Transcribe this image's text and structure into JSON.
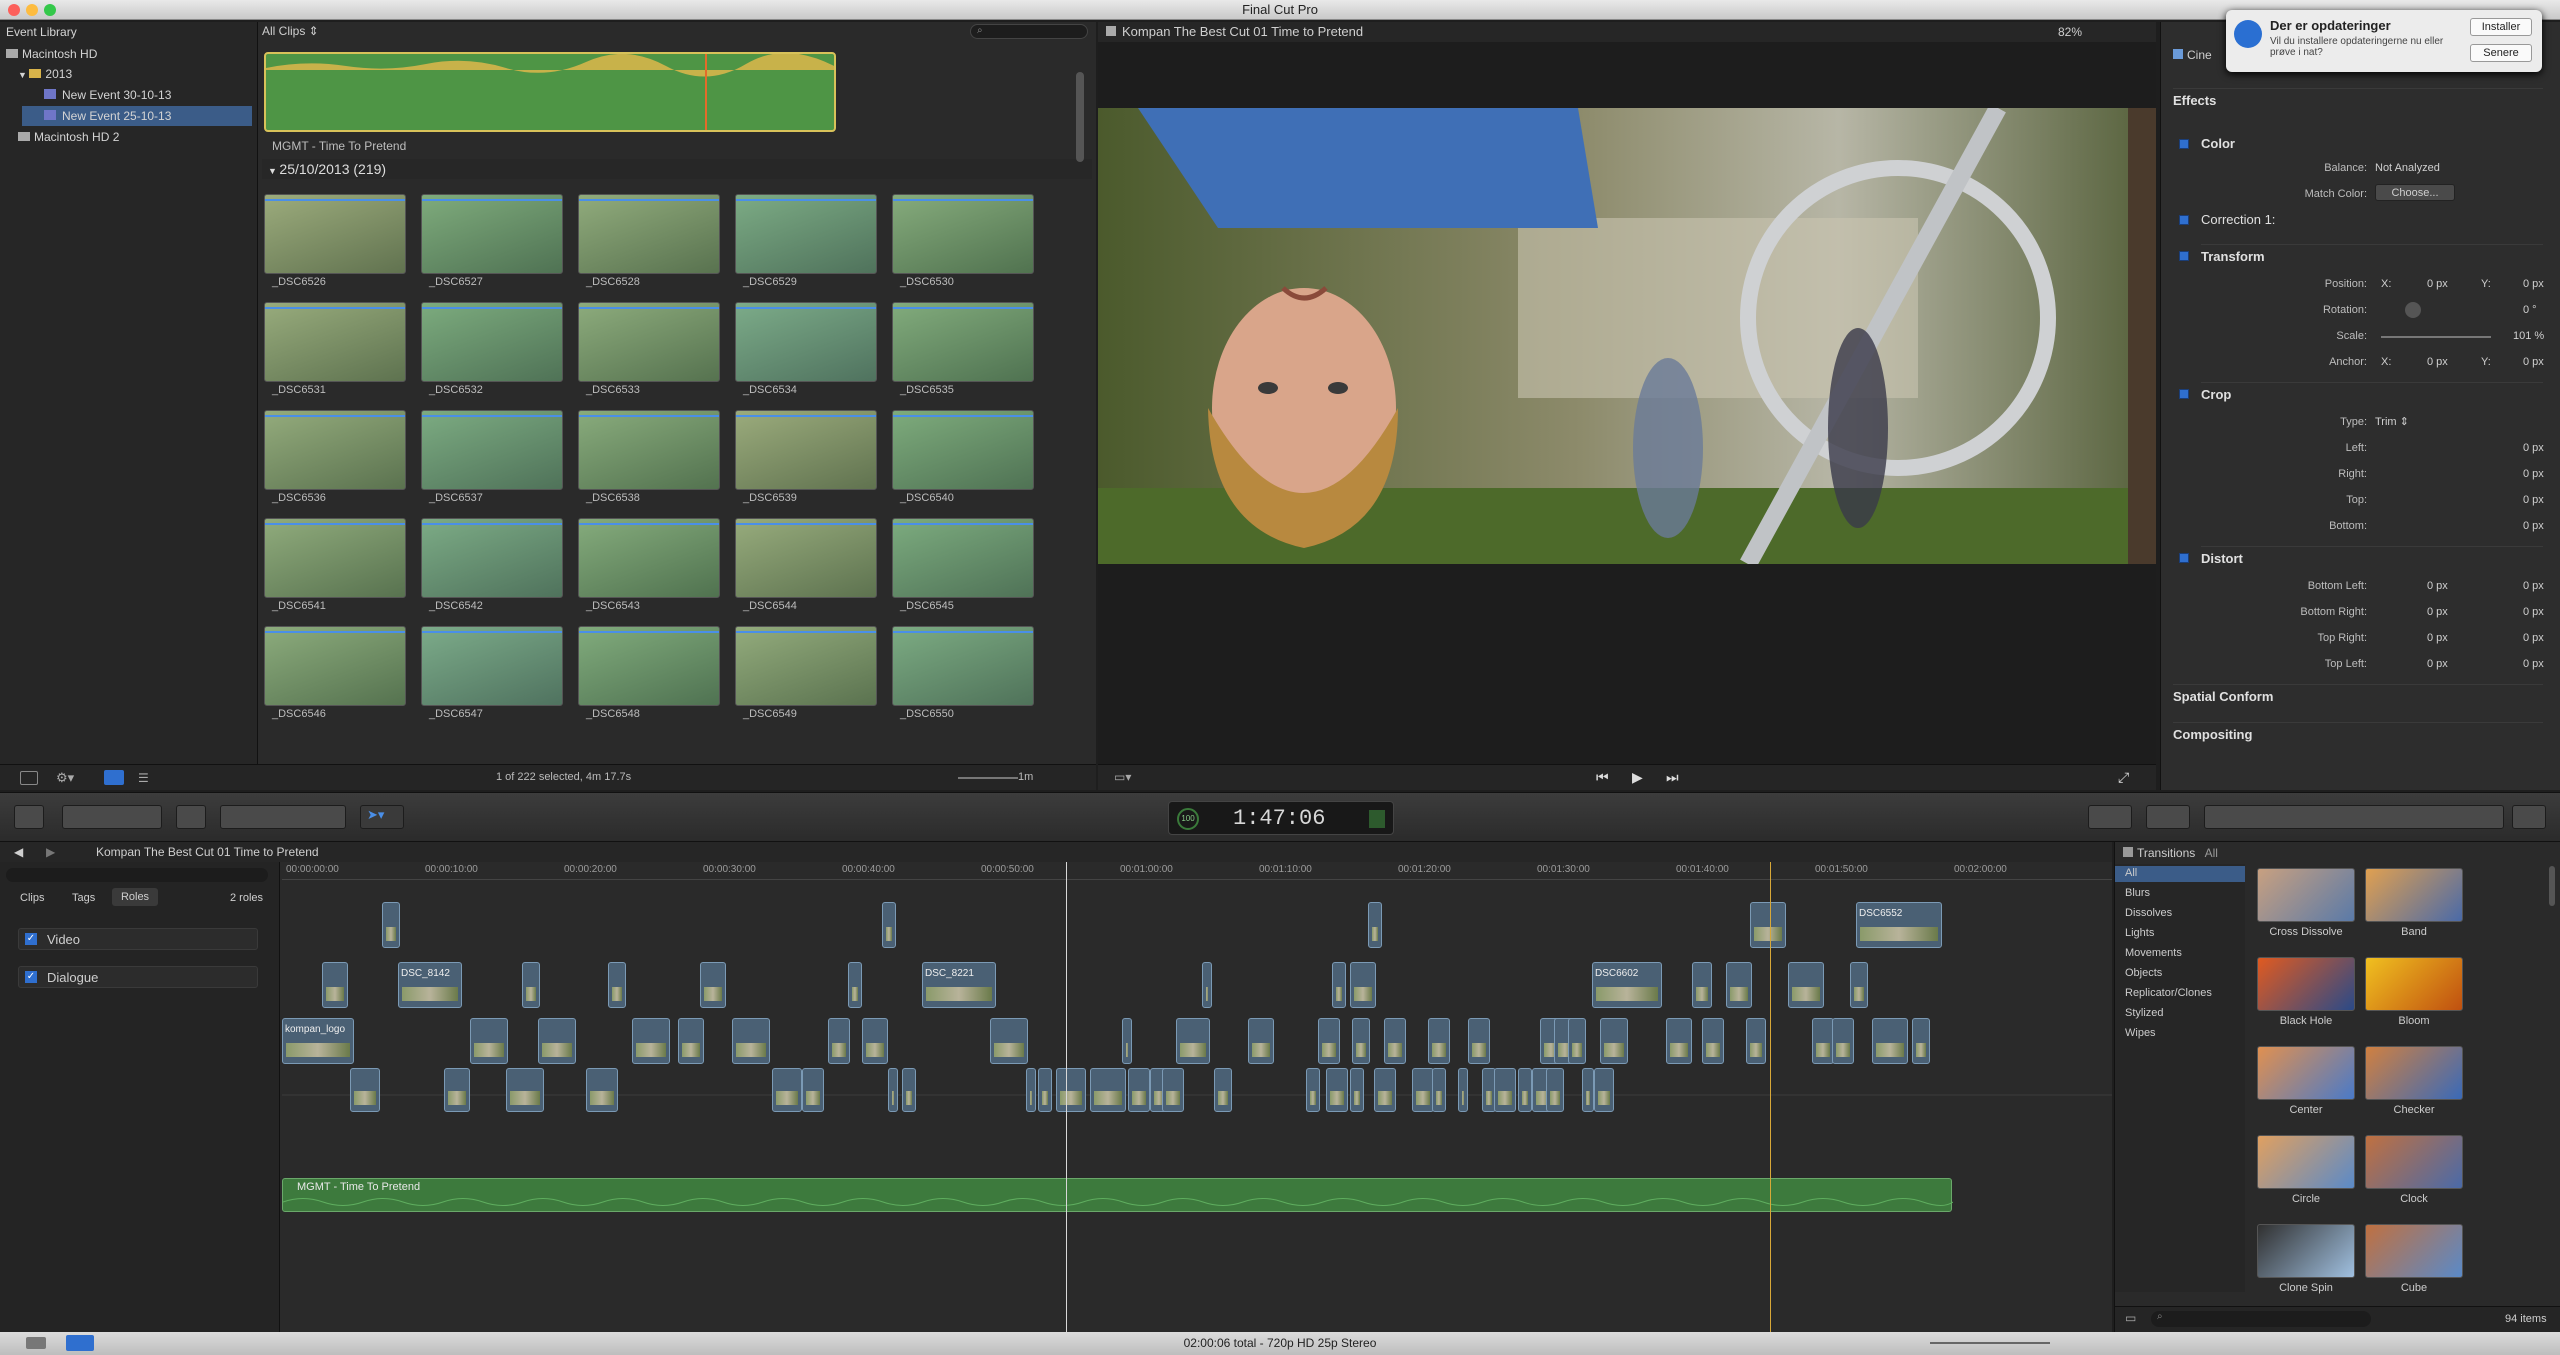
{
  "app": {
    "title": "Final Cut Pro"
  },
  "library": {
    "header": "Event Library",
    "items": [
      {
        "label": "Macintosh HD",
        "level": 0
      },
      {
        "label": "2013",
        "level": 1
      },
      {
        "label": "New Event 30-10-13",
        "level": 2
      },
      {
        "label": "New Event 25-10-13",
        "level": 2,
        "selected": true
      },
      {
        "label": "Macintosh HD 2",
        "level": 0
      }
    ]
  },
  "browser": {
    "filter": "All Clips",
    "project_clip_label": "MGMT - Time To Pretend",
    "date_group": "25/10/2013  (219)",
    "clips": [
      "_DSC6526",
      "_DSC6527",
      "_DSC6528",
      "_DSC6529",
      "_DSC6530",
      "_DSC6531",
      "_DSC6532",
      "_DSC6533",
      "_DSC6534",
      "_DSC6535",
      "_DSC6536",
      "_DSC6537",
      "_DSC6538",
      "_DSC6539",
      "_DSC6540",
      "_DSC6541",
      "_DSC6542",
      "_DSC6543",
      "_DSC6544",
      "_DSC6545",
      "_DSC6546",
      "_DSC6547",
      "_DSC6548",
      "_DSC6549",
      "_DSC6550"
    ],
    "status": "1 of 222 selected, 4m 17.7s",
    "zoom_label": "1m"
  },
  "viewer": {
    "title": "Kompan The Best Cut 01 Time to Pretend",
    "zoom": "82%"
  },
  "notification": {
    "title": "Der er opdateringer",
    "body": "Vil du installere opdateringerne nu eller prøve i nat?",
    "install": "Installer",
    "later": "Senere"
  },
  "inspector": {
    "tab": "Cine",
    "effects": "Effects",
    "color": "Color",
    "balance_label": "Balance:",
    "balance_value": "Not Analyzed",
    "match_label": "Match Color:",
    "match_button": "Choose...",
    "correction": "Correction 1:",
    "transform": "Transform",
    "position_label": "Position:",
    "rotation_label": "Rotation:",
    "rotation_value": "0 °",
    "scale_label": "Scale:",
    "scale_value": "101 %",
    "anchor_label": "Anchor:",
    "x": "X:",
    "y": "Y:",
    "px0": "0 px",
    "crop": "Crop",
    "type_label": "Type:",
    "type_value": "Trim",
    "left_label": "Left:",
    "right_label": "Right:",
    "top_label": "Top:",
    "bottom_label": "Bottom:",
    "distort": "Distort",
    "bl_label": "Bottom Left:",
    "br_label": "Bottom Right:",
    "tr_label": "Top Right:",
    "tlf_label": "Top Left:",
    "spatial": "Spatial Conform",
    "compositing": "Compositing"
  },
  "toolbar": {
    "timecode": "1:47:06",
    "tc_prefix": "100"
  },
  "timeline": {
    "project": "Kompan The Best Cut 01 Time to Pretend",
    "index_tabs": [
      "Clips",
      "Tags",
      "Roles"
    ],
    "roles_count": "2 roles",
    "roles": [
      "Video",
      "Dialogue"
    ],
    "ruler": [
      "00:00:00:00",
      "00:00:10:00",
      "00:00:20:00",
      "00:00:30:00",
      "00:00:40:00",
      "00:00:50:00",
      "00:01:00:00",
      "00:01:10:00",
      "00:01:20:00",
      "00:01:30:00",
      "00:01:40:00",
      "00:01:50:00",
      "00:02:00:00"
    ],
    "audio_clip": "MGMT - Time To Pretend",
    "clip_names": [
      "DSC6552",
      "DSC_8142",
      "DSC_8221",
      "DSC6602",
      "kompan_logo"
    ]
  },
  "transitions": {
    "title": "Transitions",
    "filter": "All",
    "categories": [
      "All",
      "Blurs",
      "Dissolves",
      "Lights",
      "Movements",
      "Objects",
      "Replicator/Clones",
      "Stylized",
      "Wipes"
    ],
    "items": [
      "Cross Dissolve",
      "Band",
      "Black Hole",
      "Bloom",
      "Center",
      "Checker",
      "Circle",
      "Clock",
      "Clone Spin",
      "Cube"
    ],
    "count": "94 items"
  },
  "status": {
    "text": "02:00:06 total - 720p HD 25p Stereo"
  }
}
